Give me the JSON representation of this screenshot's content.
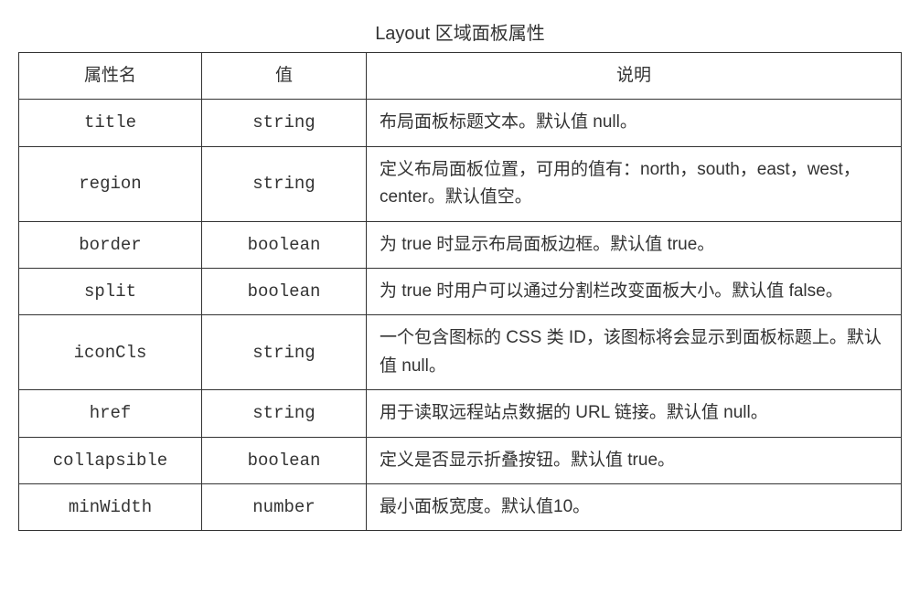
{
  "title": "Layout 区域面板属性",
  "headers": {
    "name": "属性名",
    "value": "值",
    "desc": "说明"
  },
  "rows": [
    {
      "name": "title",
      "value": "string",
      "desc": "布局面板标题文本。默认值 null。"
    },
    {
      "name": "region",
      "value": "string",
      "desc": "定义布局面板位置，可用的值有：north，south，east，west，center。默认值空。"
    },
    {
      "name": "border",
      "value": "boolean",
      "desc": "为 true 时显示布局面板边框。默认值 true。"
    },
    {
      "name": "split",
      "value": "boolean",
      "desc": "为 true 时用户可以通过分割栏改变面板大小。默认值 false。"
    },
    {
      "name": "iconCls",
      "value": "string",
      "desc": "一个包含图标的 CSS 类 ID，该图标将会显示到面板标题上。默认值 null。"
    },
    {
      "name": "href",
      "value": "string",
      "desc": "用于读取远程站点数据的 URL 链接。默认值 null。"
    },
    {
      "name": "collapsible",
      "value": "boolean",
      "desc": "定义是否显示折叠按钮。默认值 true。"
    },
    {
      "name": "minWidth",
      "value": "number",
      "desc": "最小面板宽度。默认值10。"
    }
  ]
}
